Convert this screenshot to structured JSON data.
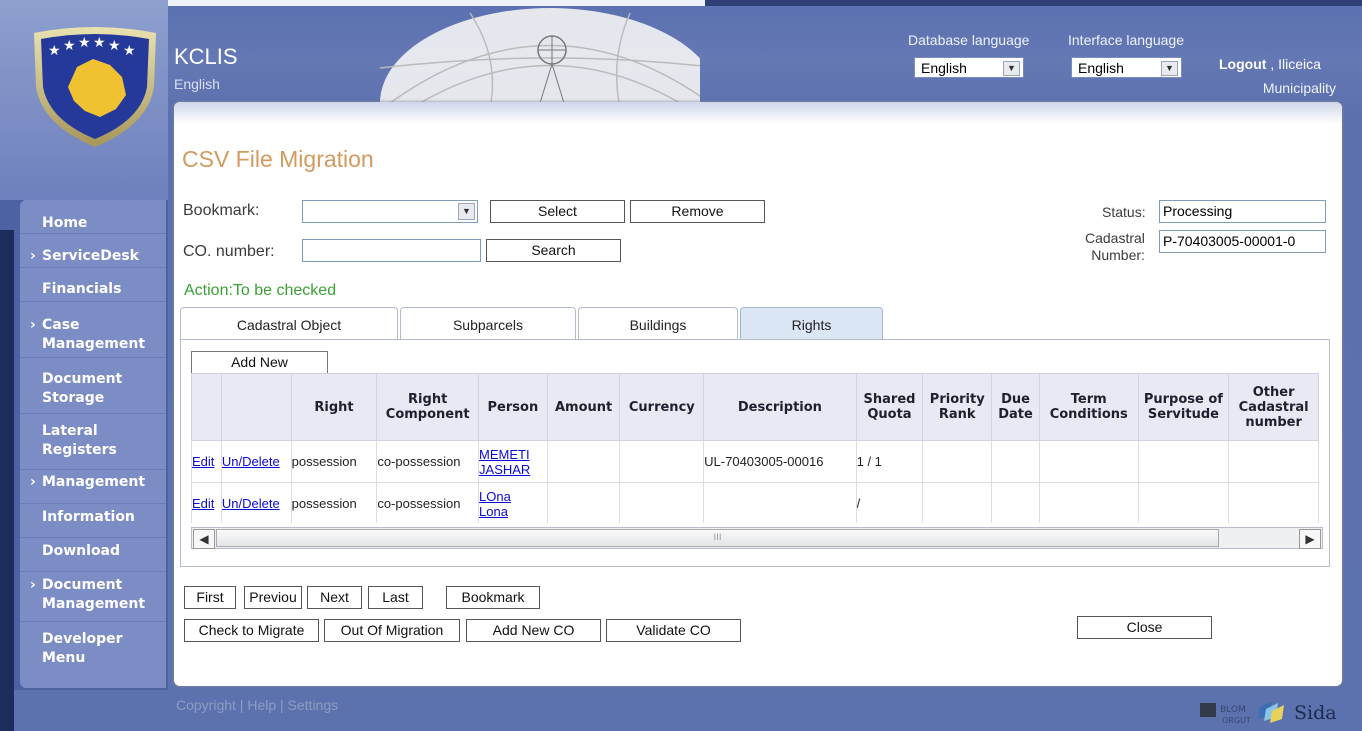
{
  "app": {
    "title": "KCLIS",
    "subtitle": "English"
  },
  "header": {
    "database_language_label": "Database language",
    "database_language_value": "English",
    "interface_language_label": "Interface language",
    "interface_language_value": "English",
    "logout_label": "Logout",
    "user": ", Iliceica",
    "municipality": "Municipality"
  },
  "nav": {
    "items": [
      {
        "label": "Home",
        "chevron": ""
      },
      {
        "label": "ServiceDesk",
        "chevron": "›"
      },
      {
        "label": "Financials",
        "chevron": ""
      },
      {
        "label": "Case Management",
        "chevron": "›"
      },
      {
        "label": "Document Storage",
        "chevron": ""
      },
      {
        "label": "Lateral Registers",
        "chevron": ""
      },
      {
        "label": "Management",
        "chevron": "›"
      },
      {
        "label": "Information",
        "chevron": ""
      },
      {
        "label": "Download",
        "chevron": ""
      },
      {
        "label": "Document Management",
        "chevron": "›"
      },
      {
        "label": "Developer Menu",
        "chevron": ""
      }
    ]
  },
  "page": {
    "title": "CSV File Migration",
    "bookmark_label": "Bookmark:",
    "select_button": "Select",
    "remove_button": "Remove",
    "co_number_label": "CO. number:",
    "co_number_value": "",
    "search_button": "Search",
    "status_label": "Status:",
    "status_value": "Processing",
    "cadastral_label_1": "Cadastral",
    "cadastral_label_2": "Number:",
    "cadastral_value": "P-70403005-00001-0",
    "action_text": "Action:To be checked"
  },
  "tabs": [
    {
      "label": "Cadastral Object",
      "active": false
    },
    {
      "label": "Subparcels",
      "active": false
    },
    {
      "label": "Buildings",
      "active": false
    },
    {
      "label": "Rights",
      "active": true
    }
  ],
  "rights": {
    "add_new": "Add New",
    "columns": [
      "",
      "",
      "Right",
      "Right Component",
      "Person",
      "Amount",
      "Currency",
      "Description",
      "Shared Quota",
      "Priority Rank",
      "Due Date",
      "Term Conditions",
      "Purpose of Servitude",
      "Other Cadastral number"
    ],
    "rows": [
      {
        "edit": "Edit",
        "undelete": "Un/Delete",
        "right": "possession",
        "component": "co-possession",
        "person_1": "MEMETI",
        "person_2": "JASHAR",
        "amount": "",
        "currency": "",
        "description": "UL-70403005-00016",
        "shared_quota": "1 / 1",
        "priority": "",
        "due": "",
        "term": "",
        "purpose": "",
        "other": ""
      },
      {
        "edit": "Edit",
        "undelete": "Un/Delete",
        "right": "possession",
        "component": "co-possession",
        "person_1": "LOna",
        "person_2": "Lona",
        "amount": "",
        "currency": "",
        "description": "",
        "shared_quota": "/",
        "priority": "",
        "due": "",
        "term": "",
        "purpose": "",
        "other": ""
      }
    ]
  },
  "buttons": {
    "first": "First",
    "previous": "Previou",
    "next": "Next",
    "last": "Last",
    "bookmark": "Bookmark",
    "check_to_migrate": "Check to Migrate",
    "out_of_migration": "Out Of Migration",
    "add_new_co": "Add New CO",
    "validate_co": "Validate CO",
    "close": "Close"
  },
  "footer": {
    "links": "Copyright | Help | Settings",
    "logo_1": "BLOM",
    "logo_2": "ORGUT",
    "logo_3": "Sida"
  },
  "colors": {
    "accent": "#d49a5d",
    "action_green": "#3aa135",
    "nav_bg": "#7c8cc4",
    "page_bg": "#5c72ae"
  }
}
